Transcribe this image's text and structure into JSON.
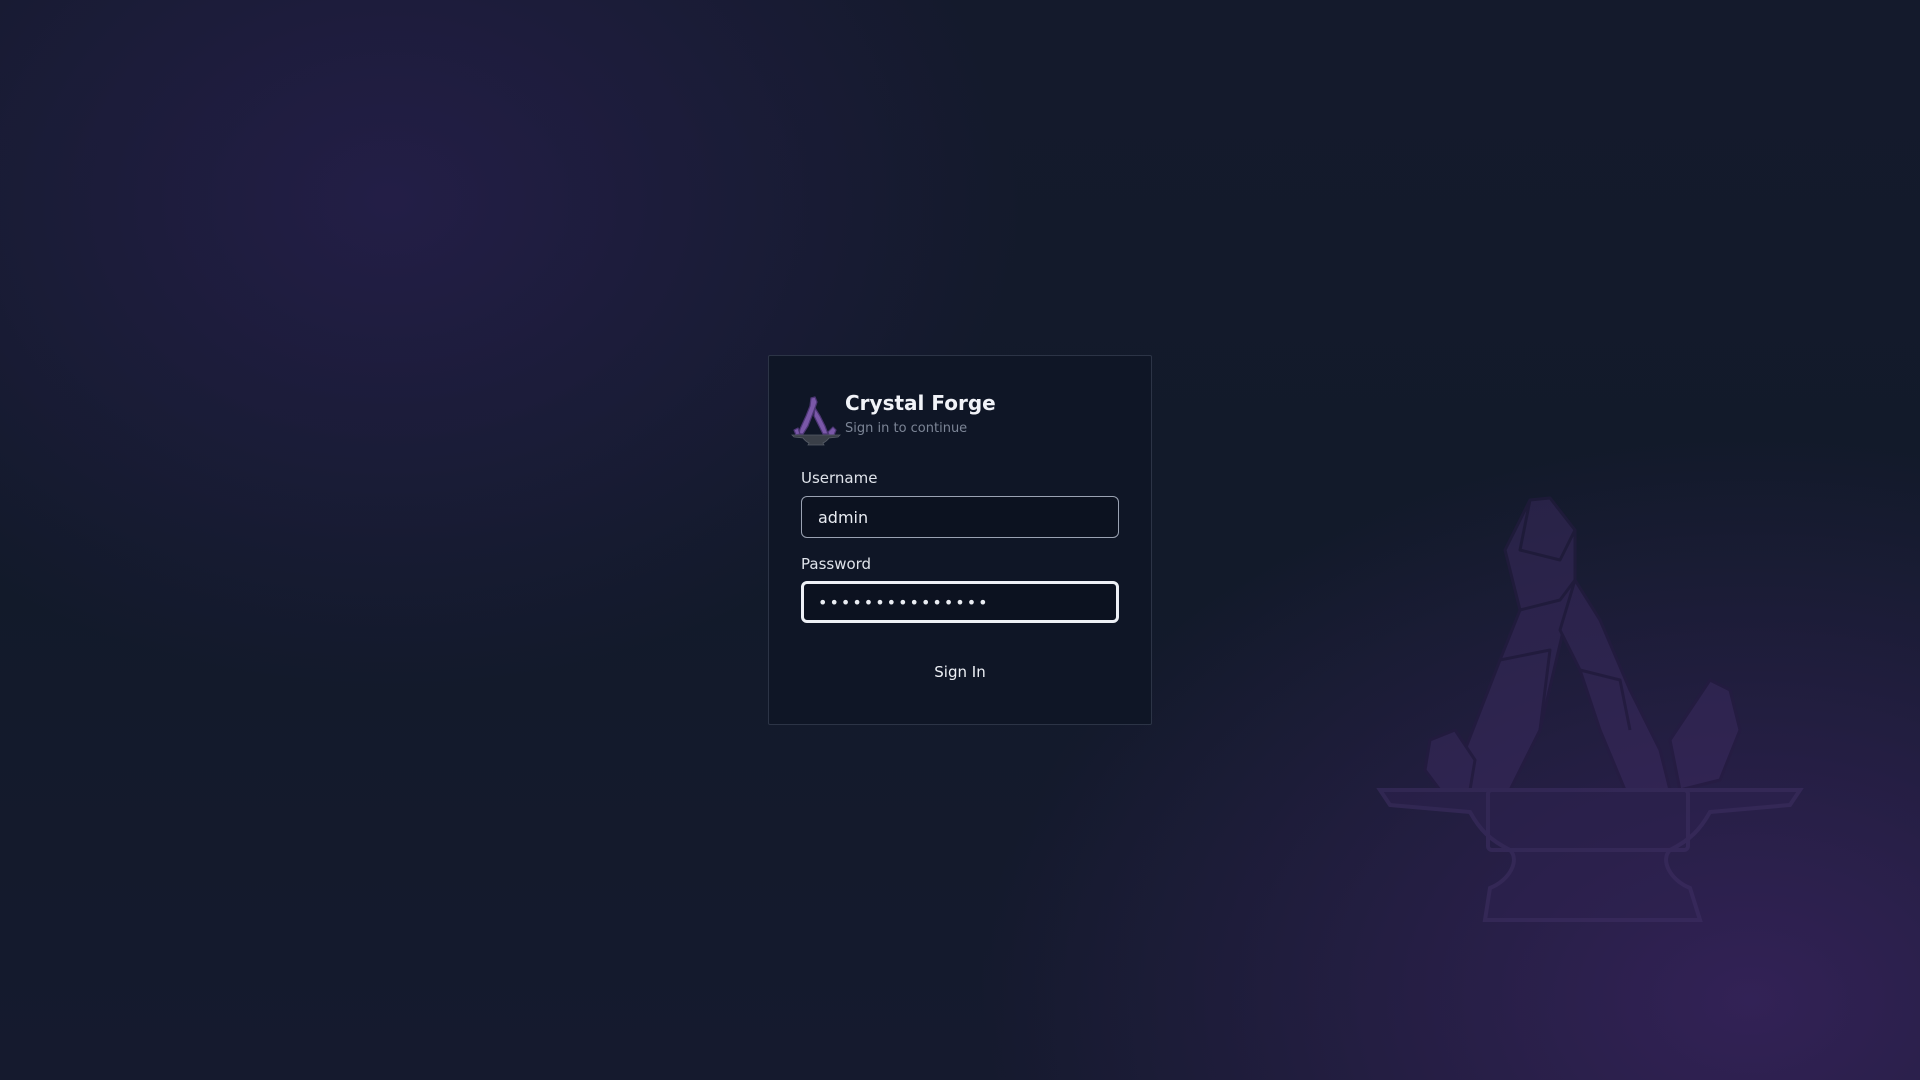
{
  "app": {
    "title": "Crystal Forge",
    "subtitle": "Sign in to continue",
    "logo_icon": "crystal-anvil-icon",
    "background_icon": "crystal-anvil-icon"
  },
  "form": {
    "username_label": "Username",
    "username_value": "admin",
    "password_label": "Password",
    "password_value": "•••••••••••••••",
    "submit_label": "Sign In"
  },
  "colors": {
    "card_background": "#0f1626",
    "accent_purple": "#7a58a8",
    "focus_border": "#eef1f6"
  }
}
